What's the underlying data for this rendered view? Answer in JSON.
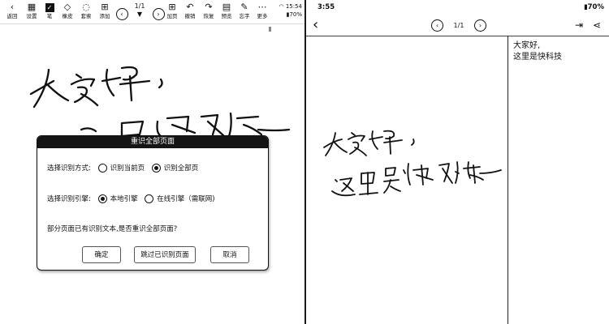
{
  "left": {
    "toolbar": {
      "items": [
        {
          "label": "返回",
          "icon": "back-chevron"
        },
        {
          "label": "设置",
          "icon": "settings-grid"
        },
        {
          "label": "笔",
          "icon": "pen-check"
        },
        {
          "label": "橡皮",
          "icon": "eraser"
        },
        {
          "label": "套索",
          "icon": "lasso"
        },
        {
          "label": "添加",
          "icon": "add-page"
        }
      ],
      "items_right": [
        {
          "label": "加页",
          "icon": "add-page"
        },
        {
          "label": "撤销",
          "icon": "undo"
        },
        {
          "label": "恢复",
          "icon": "redo"
        },
        {
          "label": "预览",
          "icon": "preview"
        },
        {
          "label": "忘字",
          "icon": "forgot-char"
        },
        {
          "label": "更多",
          "icon": "more-dots"
        }
      ],
      "page": "1/1",
      "time": "15:54",
      "battery": "70%"
    },
    "dialog": {
      "title": "重识全部页面",
      "mode_label": "选择识别方式:",
      "mode_option_current": "识别当前页",
      "mode_option_all": "识别全部页",
      "mode_selected": "识别全部页",
      "engine_label": "选择识别引擎:",
      "engine_option_local": "本地引擎",
      "engine_option_online": "在线引擎（需联网)",
      "engine_selected": "本地引擎",
      "message": "部分页面已有识别文本,是否重识全部页面?",
      "confirm": "确定",
      "skip": "跳过已识别页面",
      "cancel": "取消"
    }
  },
  "right": {
    "status": {
      "time": "3:55",
      "battery": "70%"
    },
    "page": "1/1",
    "recognized_text": "大家好,\n这里是快科技"
  },
  "colors": {
    "ink": "#111111",
    "dialog_title_bg": "#141414",
    "background": "#ffffff"
  }
}
